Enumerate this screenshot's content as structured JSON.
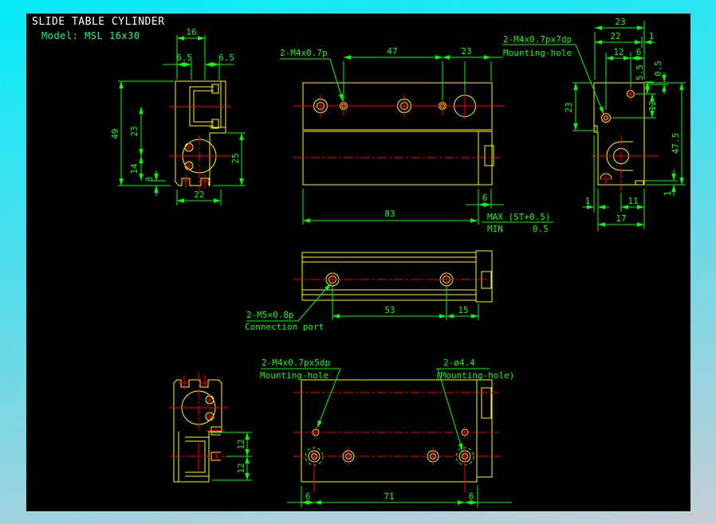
{
  "header": {
    "title": "SLIDE TABLE CYLINDER",
    "model": "Model: MSL 16x30"
  },
  "colors": {
    "outline": "#ffff00",
    "centerline": "#ff0000",
    "dimension": "#00ff00",
    "title": "#ffffff",
    "model": "#00ff7f",
    "canvas": "#000000",
    "frame_top": "#06ecf8",
    "frame_bottom": "#c6ced6"
  },
  "views": {
    "left": {
      "d16": "16",
      "d65l": "6.5",
      "d65r": "6.5",
      "d49": "49",
      "d23": "23",
      "d14": "14",
      "d3": "3",
      "d25": "25",
      "d22": "22"
    },
    "front": {
      "thread_label": "2-M4x0.7p",
      "d47": "47",
      "d23": "23",
      "d6": "6",
      "d83": "83",
      "max_label": "MAX (ST+0.5)",
      "min_label": "MIN",
      "min_value": "0.5"
    },
    "right": {
      "mount_label": "2-M4x0.7px7dp",
      "mount_sublabel": "Mounting-hole",
      "d23t": "23",
      "d22": "22",
      "d1t": "1",
      "d12t": "12",
      "d6t": "6",
      "d55": "5.5",
      "d05": "0.5",
      "d23l": "23",
      "d12r": "12",
      "d475": "47.5",
      "d1r": "1",
      "d1b": "1",
      "d11": "11",
      "d17": "17"
    },
    "top": {
      "port_label": "2-M5×0.8p",
      "port_sublabel": "Connection port",
      "d53": "53",
      "d15": "15"
    },
    "bottom": {
      "mount_label": "2-M4x0.7px5dp",
      "mount_sublabel": "Mounting-hole",
      "dia_label": "2-ø4.4",
      "dia_sublabel": "(Mounting-hole)",
      "d6l": "6",
      "d71": "71",
      "d6r": "6"
    },
    "bottom_left": {
      "d12a": "12",
      "d12b": "12"
    }
  }
}
